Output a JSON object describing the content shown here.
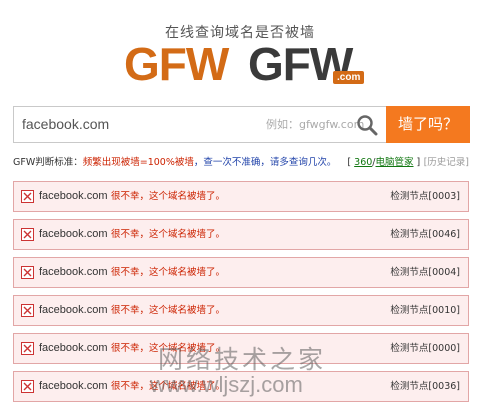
{
  "header": {
    "tagline": "在线查询域名是否被墙",
    "logo_part1": "GFW",
    "logo_part2": "GFW",
    "logo_suffix": ".com"
  },
  "search": {
    "value": "facebook.com",
    "placeholder": "例如：gfwgfw.com",
    "search_icon": "magnifier-icon",
    "button_label": "墙了吗？"
  },
  "criteria": {
    "label": "GFW判断标准：",
    "rule": "频繁出现被墙=100%被墙",
    "tip": "，查一次不准确，请多查询几次。",
    "bracket_open": "[",
    "link1": "360",
    "sep": "/",
    "link2": "电脑管家",
    "bracket_close": "]",
    "history": "[历史记录]"
  },
  "results": [
    {
      "domain": "facebook.com",
      "message": "很不幸，这个域名被墙了。",
      "node": "检测节点[0003]",
      "status_icon": "blocked-x-icon"
    },
    {
      "domain": "facebook.com",
      "message": "很不幸，这个域名被墙了。",
      "node": "检测节点[0046]",
      "status_icon": "blocked-x-icon"
    },
    {
      "domain": "facebook.com",
      "message": "很不幸，这个域名被墙了。",
      "node": "检测节点[0004]",
      "status_icon": "blocked-x-icon"
    },
    {
      "domain": "facebook.com",
      "message": "很不幸，这个域名被墙了。",
      "node": "检测节点[0010]",
      "status_icon": "blocked-x-icon"
    },
    {
      "domain": "facebook.com",
      "message": "很不幸，这个域名被墙了。",
      "node": "检测节点[0000]",
      "status_icon": "blocked-x-icon"
    },
    {
      "domain": "facebook.com",
      "message": "很不幸，这个域名被墙了。",
      "node": "检测节点[0036]",
      "status_icon": "blocked-x-icon"
    }
  ],
  "watermark": {
    "text_cn": "网络技术之家",
    "url": "www.wljszj.com"
  },
  "colors": {
    "accent": "#f4791f",
    "logo_orange": "#d36b16",
    "logo_dark": "#3a3a3a",
    "error_red": "#cc2200",
    "row_bg": "#fdeeee",
    "row_border": "#e2a6a6"
  }
}
